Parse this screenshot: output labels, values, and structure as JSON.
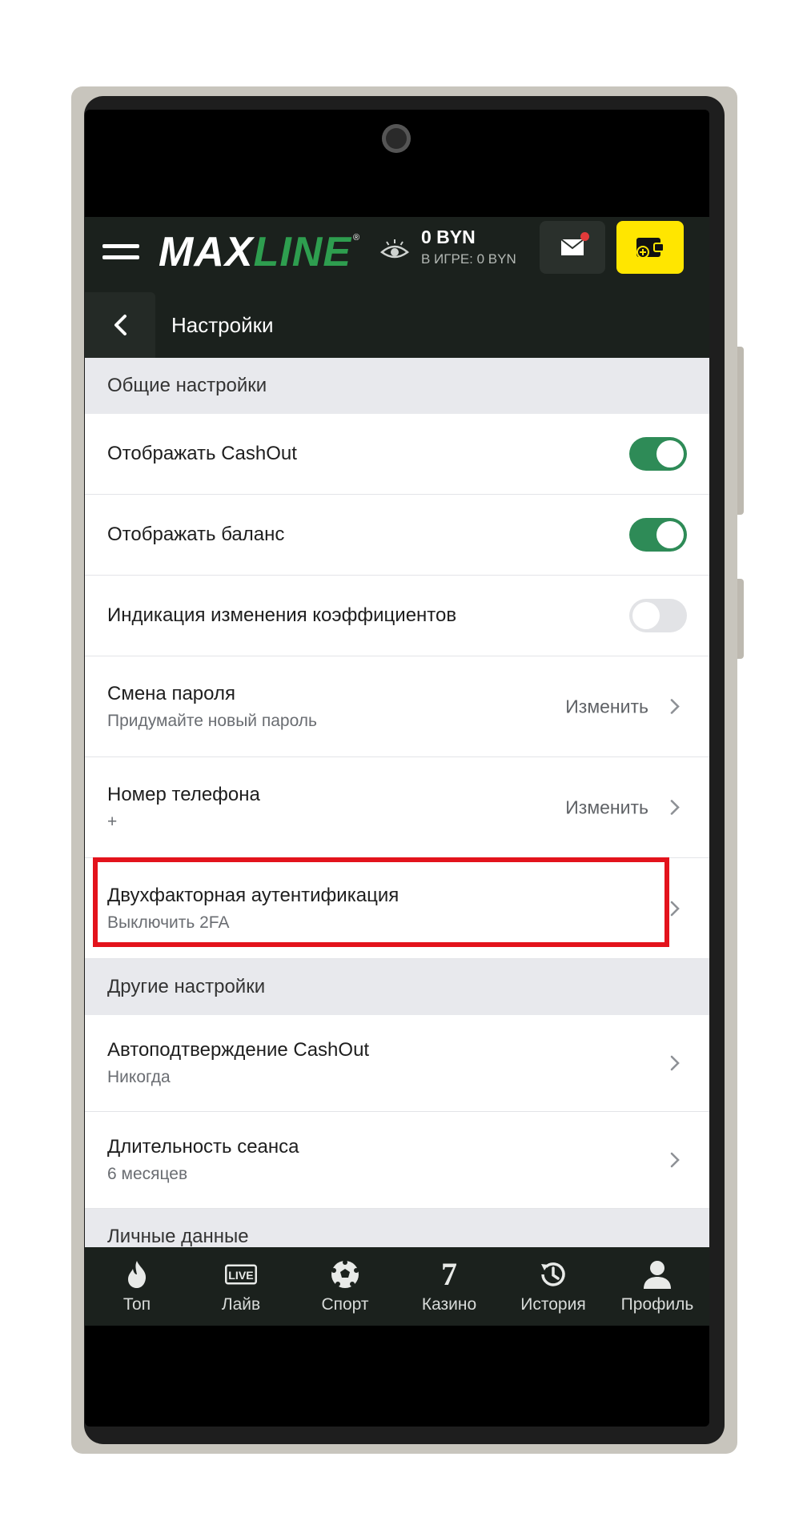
{
  "header": {
    "logo_left": "MAX",
    "logo_right": "LINE",
    "logo_reg": "®",
    "balance": "0 BYN",
    "in_game": "В ИГРЕ: 0 BYN",
    "page_title": "Настройки"
  },
  "sections": {
    "general": "Общие настройки",
    "other": "Другие настройки",
    "personal": "Личные данные"
  },
  "settings": {
    "cashout_display": {
      "label": "Отображать CashOut",
      "enabled": true
    },
    "balance_display": {
      "label": "Отображать баланс",
      "enabled": true
    },
    "odds_indication": {
      "label": "Индикация изменения коэффициентов",
      "enabled": false
    },
    "password": {
      "label": "Смена пароля",
      "sub": "Придумайте новый пароль",
      "action": "Изменить"
    },
    "phone": {
      "label": "Номер телефона",
      "sub": "+",
      "action": "Изменить"
    },
    "two_fa": {
      "label": "Двухфакторная аутентификация",
      "sub": "Выключить 2FA"
    },
    "auto_cashout": {
      "label": "Автоподтверждение CashOut",
      "sub": "Никогда"
    },
    "session": {
      "label": "Длительность сеанса",
      "sub": "6 месяцев"
    }
  },
  "nav": {
    "top": "Топ",
    "live": "Лайв",
    "live_icon_text": "LIVE",
    "sport": "Спорт",
    "casino": "Казино",
    "casino_icon_text": "7",
    "history": "История",
    "profile": "Профиль"
  },
  "colors": {
    "header_bg": "#1b211d",
    "brand_green": "#2e9e4f",
    "toggle_on": "#2e8b57",
    "wallet_yellow": "#ffe600",
    "highlight_red": "#e3131c"
  }
}
